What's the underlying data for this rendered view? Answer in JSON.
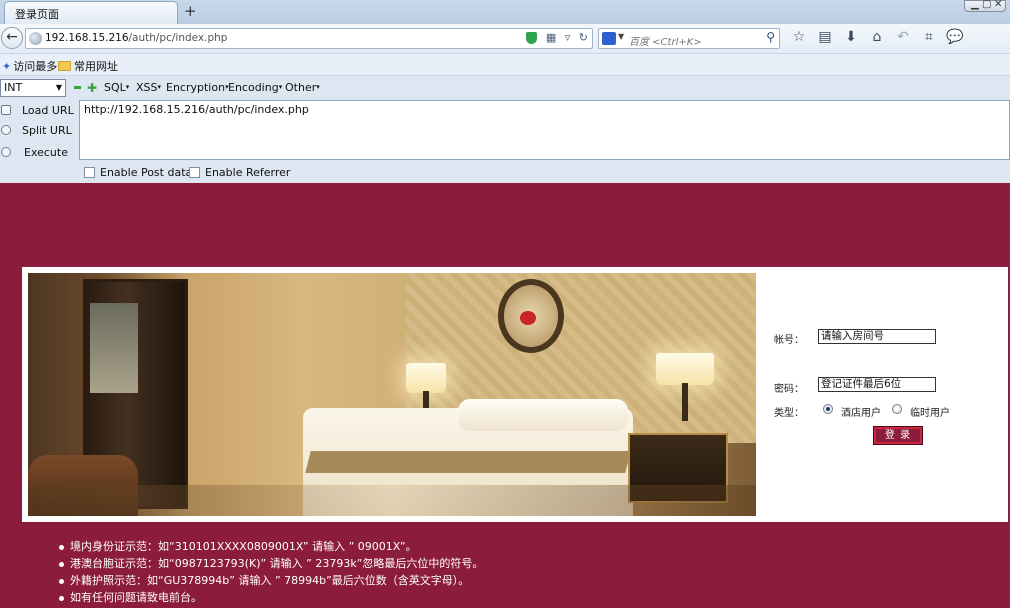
{
  "browser": {
    "tab_title": "登录页面",
    "new_tab": "+",
    "url_host": "192.168.15.216",
    "url_path": "/auth/pc/index.php",
    "search_placeholder": "百度 <Ctrl+K>",
    "bookmarks": [
      "访问最多",
      "常用网址"
    ]
  },
  "hackbar": {
    "select_value": "INT",
    "menus": [
      "SQL",
      "XSS",
      "Encryption",
      "Encoding",
      "Other"
    ],
    "load_url": "Load URL",
    "split_url": "Split URL",
    "execute": "Execute",
    "url_value": "http://192.168.15.216/auth/pc/index.php",
    "enable_post": "Enable Post data",
    "enable_referrer": "Enable Referrer"
  },
  "login": {
    "account_label": "帐号：",
    "account_value": "请输入房间号",
    "password_label": "密码：",
    "password_value": "登记证件最后6位",
    "type_label": "类型：",
    "type_options": [
      "酒店用户",
      "临时用户"
    ],
    "type_selected": "酒店用户",
    "submit_label": "登 录"
  },
  "notes": [
    "境内身份证示范：如“310101XXXX08090­01X” 请输入 ” 09001X”。",
    "港澳台胞证示范：如“0987123793(K)” 请输入 ” 23793k”忽略最后六位中的符号。",
    "外籍护照示范：如“GU378994b” 请输入 ” 78994b”最后六位数（含英文字母）。",
    "如有任何问题请致电前台。"
  ],
  "colors": {
    "page_bg": "#8c1c3c",
    "button_border": "#c9283e",
    "panel_bg": "#ffffff"
  },
  "icons": [
    "back-icon",
    "globe-icon",
    "shield-icon",
    "qr-icon",
    "search-icon",
    "bookmark-star-icon",
    "reader-icon",
    "download-icon",
    "home-icon",
    "undo-icon",
    "crop-icon",
    "chat-icon"
  ]
}
